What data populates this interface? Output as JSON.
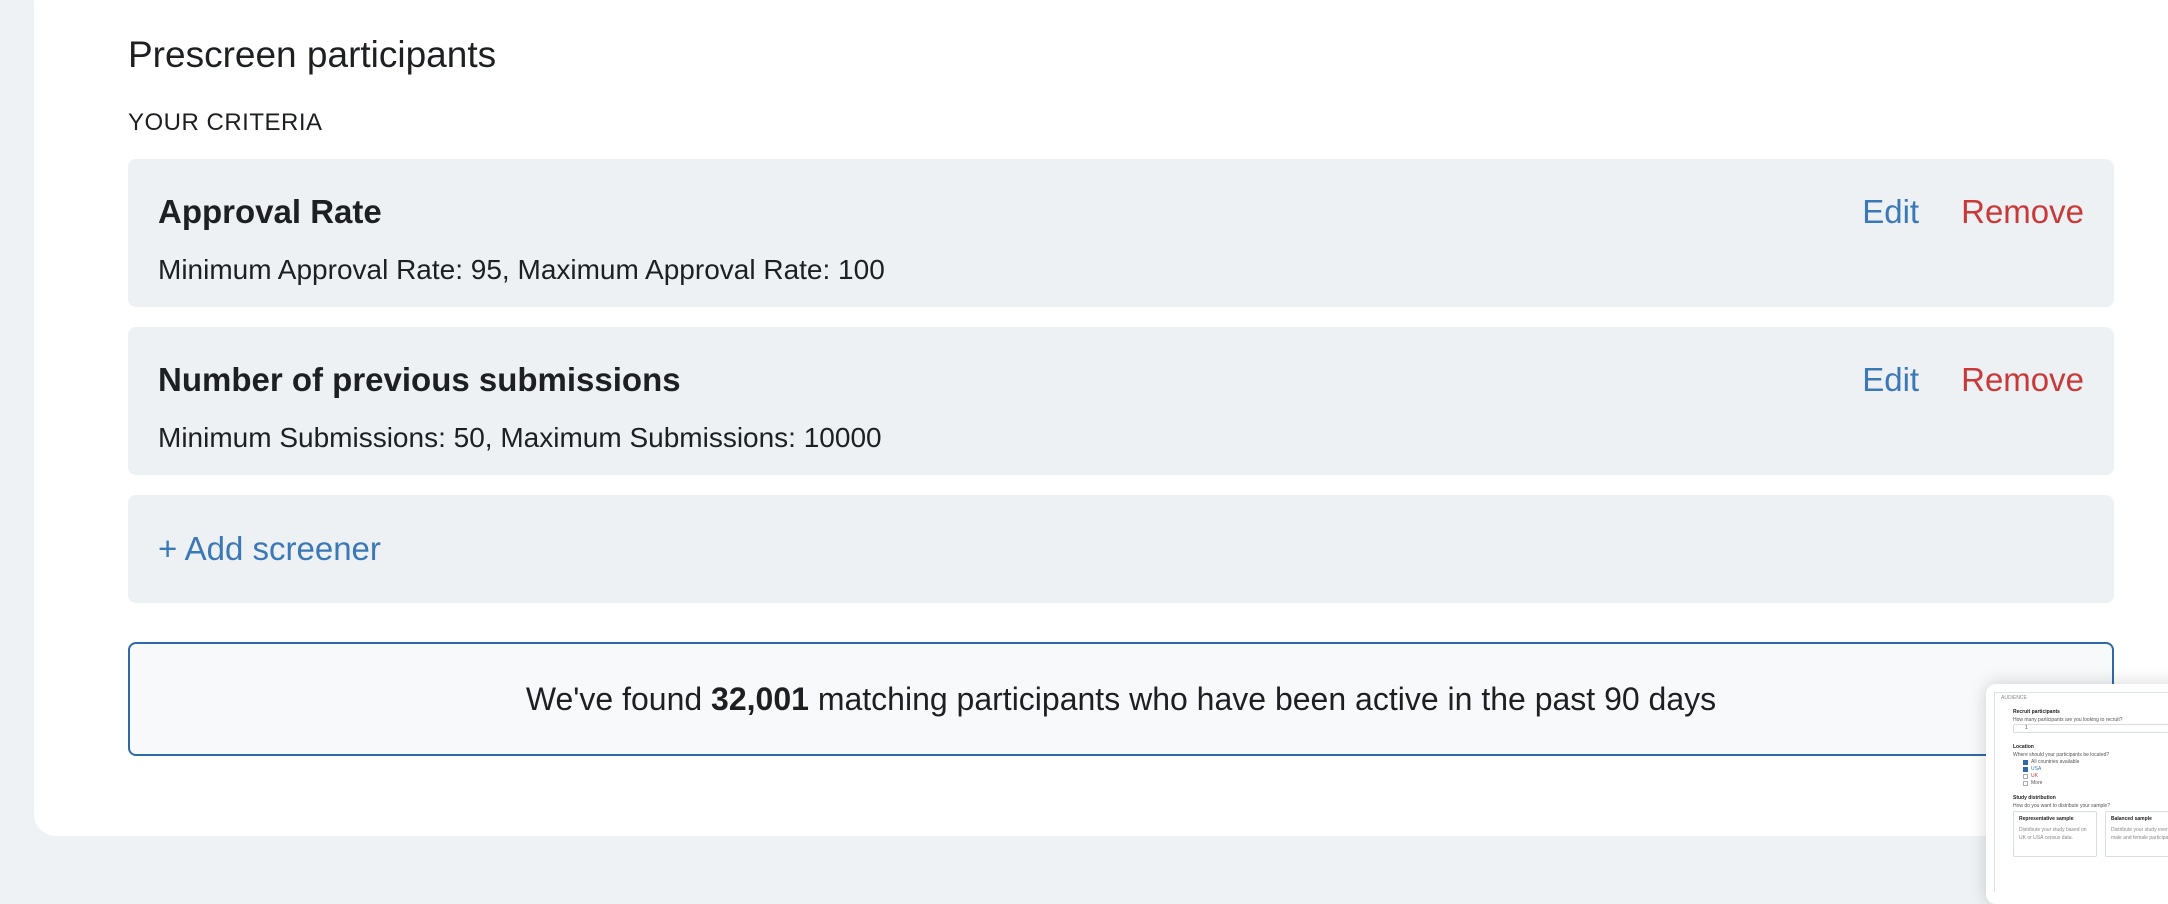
{
  "section": {
    "title": "Prescreen participants",
    "criteria_label": "YOUR CRITERIA"
  },
  "criteria": [
    {
      "title": "Approval Rate",
      "description": "Minimum Approval Rate: 95, Maximum Approval Rate: 100",
      "edit_label": "Edit",
      "remove_label": "Remove"
    },
    {
      "title": "Number of previous submissions",
      "description": "Minimum Submissions: 50, Maximum Submissions: 10000",
      "edit_label": "Edit",
      "remove_label": "Remove"
    }
  ],
  "add_screener_label": "+ Add screener",
  "result": {
    "prefix": "We've found ",
    "count": "32,001",
    "suffix": " matching participants who have been active in the past 90 days"
  },
  "thumbnail": {
    "header": "AUDIENCE",
    "recruit_title": "Recruit participants",
    "recruit_question": "How many participants are you looking to recruit?",
    "recruit_value": "1",
    "location_title": "Location",
    "location_question": "Where should your participants be located?",
    "location_options": [
      "All countries available",
      "USA",
      "UK",
      "More"
    ],
    "distribution_title": "Study distribution",
    "distribution_question": "How do you want to distribute your sample?",
    "option_a_title": "Representative sample",
    "option_a_desc": "Distribute your study based on UK or USA census data.",
    "option_b_title": "Balanced sample",
    "option_b_desc": "Distribute your study evenly to male and female participants."
  },
  "colors": {
    "link": "#3a78b6",
    "danger": "#c83a3a",
    "card_bg": "#eef1f4",
    "highlight_border": "#2f6aa8",
    "page_bg": "#eff2f5"
  }
}
